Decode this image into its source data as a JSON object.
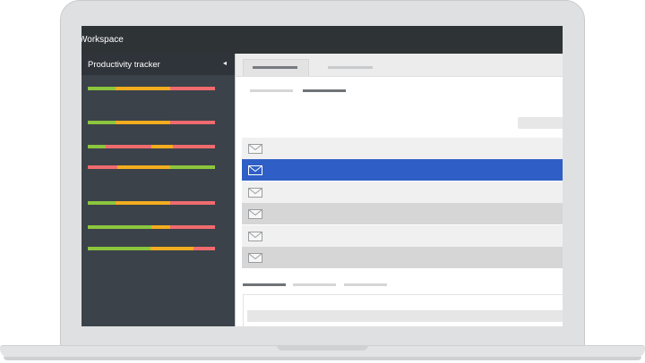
{
  "window": {
    "title": "Workspace"
  },
  "sidebar": {
    "title": "Productivity tracker",
    "collapse_glyph": "◂",
    "bars": [
      {
        "segments": [
          {
            "color": "#8cc63e",
            "fraction": 0.22
          },
          {
            "color": "#f3ad1f",
            "fraction": 0.43
          },
          {
            "color": "#f06b6e",
            "fraction": 0.35
          }
        ]
      },
      {
        "segments": [
          {
            "color": "#8cc63e",
            "fraction": 0.22
          },
          {
            "color": "#f3ad1f",
            "fraction": 0.43
          },
          {
            "color": "#f06b6e",
            "fraction": 0.35
          }
        ]
      },
      {
        "segments": [
          {
            "color": "#8cc63e",
            "fraction": 0.14
          },
          {
            "color": "#f06b6e",
            "fraction": 0.36
          },
          {
            "color": "#f3ad1f",
            "fraction": 0.17
          },
          {
            "color": "#f06b6e",
            "fraction": 0.33
          }
        ]
      },
      {
        "segments": [
          {
            "color": "#f06b6e",
            "fraction": 0.23
          },
          {
            "color": "#f3ad1f",
            "fraction": 0.42
          },
          {
            "color": "#8cc63e",
            "fraction": 0.35
          }
        ]
      },
      {
        "segments": [
          {
            "color": "#8cc63e",
            "fraction": 0.22
          },
          {
            "color": "#f3ad1f",
            "fraction": 0.43
          },
          {
            "color": "#f06b6e",
            "fraction": 0.35
          }
        ]
      },
      {
        "segments": [
          {
            "color": "#8cc63e",
            "fraction": 0.5
          },
          {
            "color": "#f3ad1f",
            "fraction": 0.15
          },
          {
            "color": "#f06b6e",
            "fraction": 0.35
          }
        ]
      },
      {
        "segments": [
          {
            "color": "#8cc63e",
            "fraction": 0.49
          },
          {
            "color": "#f3ad1f",
            "fraction": 0.34
          },
          {
            "color": "#f06b6e",
            "fraction": 0.17
          }
        ]
      }
    ]
  },
  "colors": {
    "titlebar": "#2e3336",
    "sidebar": "#3c4249",
    "selected_row": "#2f5fc6",
    "row_light": "#f0f0f0",
    "row_dark": "#d6d6d6"
  },
  "mail": {
    "icon": "envelope-icon",
    "rows": [
      {
        "state": "normal",
        "shade": "light"
      },
      {
        "state": "selected",
        "shade": "selected"
      },
      {
        "state": "normal",
        "shade": "light"
      },
      {
        "state": "normal",
        "shade": "dark"
      },
      {
        "state": "normal",
        "shade": "light"
      },
      {
        "state": "normal",
        "shade": "dark"
      }
    ]
  }
}
